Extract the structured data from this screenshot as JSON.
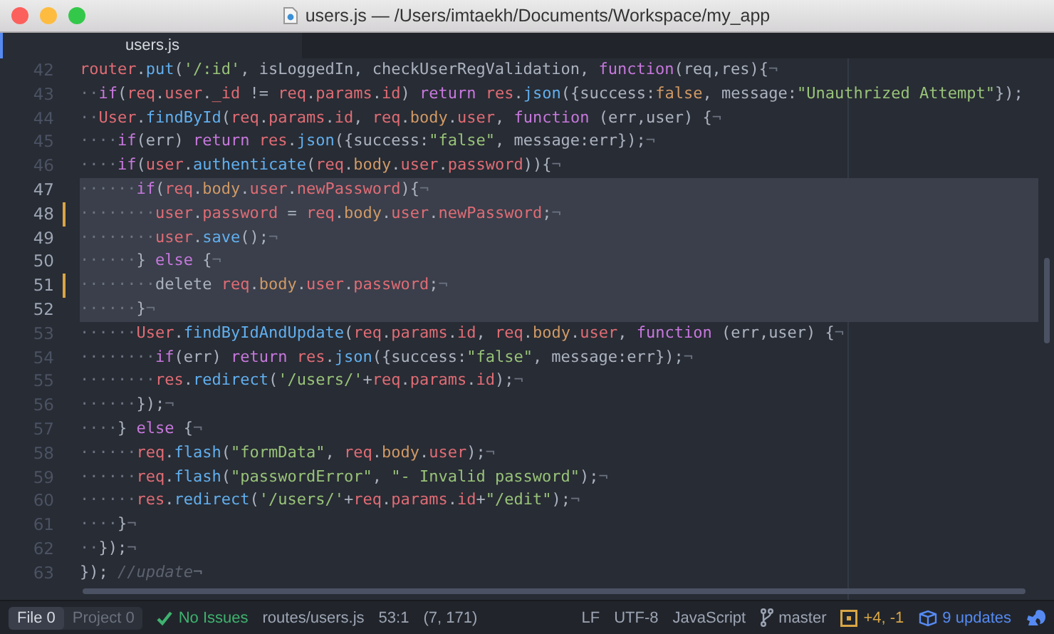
{
  "window": {
    "title": "users.js — /Users/imtaekh/Documents/Workspace/my_app"
  },
  "tabs": [
    {
      "label": "users.js",
      "selected": true
    }
  ],
  "lines": [
    {
      "number": "42",
      "selected": false,
      "modified": false,
      "tokens": [
        {
          "text": "router",
          "kind": "variable"
        },
        {
          "text": ".",
          "kind": "plain"
        },
        {
          "text": "put",
          "kind": "function"
        },
        {
          "text": "(",
          "kind": "plain"
        },
        {
          "text": "'/:id'",
          "kind": "string"
        },
        {
          "text": ", isLoggedIn, checkUserRegValidation, ",
          "kind": "plain"
        },
        {
          "text": "function",
          "kind": "keyword"
        },
        {
          "text": "(req,res){",
          "kind": "plain"
        },
        {
          "text": "¬",
          "kind": "invisible"
        }
      ]
    },
    {
      "number": "43",
      "selected": false,
      "modified": false,
      "tokens": [
        {
          "text": "··",
          "kind": "invisible"
        },
        {
          "text": "if",
          "kind": "keyword"
        },
        {
          "text": "(",
          "kind": "plain"
        },
        {
          "text": "req",
          "kind": "variable"
        },
        {
          "text": ".",
          "kind": "plain"
        },
        {
          "text": "user",
          "kind": "variable"
        },
        {
          "text": ".",
          "kind": "plain"
        },
        {
          "text": "_id",
          "kind": "variable"
        },
        {
          "text": " != ",
          "kind": "plain"
        },
        {
          "text": "req",
          "kind": "variable"
        },
        {
          "text": ".",
          "kind": "plain"
        },
        {
          "text": "params",
          "kind": "variable"
        },
        {
          "text": ".",
          "kind": "plain"
        },
        {
          "text": "id",
          "kind": "variable"
        },
        {
          "text": ") ",
          "kind": "plain"
        },
        {
          "text": "return ",
          "kind": "keyword"
        },
        {
          "text": "res",
          "kind": "variable"
        },
        {
          "text": ".",
          "kind": "plain"
        },
        {
          "text": "json",
          "kind": "function"
        },
        {
          "text": "({success:",
          "kind": "plain"
        },
        {
          "text": "false",
          "kind": "constant"
        },
        {
          "text": ", message:",
          "kind": "plain"
        },
        {
          "text": "\"Unauthrized Attempt\"",
          "kind": "string"
        },
        {
          "text": "});",
          "kind": "plain"
        }
      ]
    },
    {
      "number": "44",
      "selected": false,
      "modified": false,
      "tokens": [
        {
          "text": "··",
          "kind": "invisible"
        },
        {
          "text": "User",
          "kind": "variable"
        },
        {
          "text": ".",
          "kind": "plain"
        },
        {
          "text": "findById",
          "kind": "function"
        },
        {
          "text": "(",
          "kind": "plain"
        },
        {
          "text": "req",
          "kind": "variable"
        },
        {
          "text": ".",
          "kind": "plain"
        },
        {
          "text": "params",
          "kind": "variable"
        },
        {
          "text": ".",
          "kind": "plain"
        },
        {
          "text": "id",
          "kind": "variable"
        },
        {
          "text": ", ",
          "kind": "plain"
        },
        {
          "text": "req",
          "kind": "variable"
        },
        {
          "text": ".",
          "kind": "plain"
        },
        {
          "text": "body",
          "kind": "constant"
        },
        {
          "text": ".",
          "kind": "plain"
        },
        {
          "text": "user",
          "kind": "variable"
        },
        {
          "text": ", ",
          "kind": "plain"
        },
        {
          "text": "function",
          "kind": "keyword"
        },
        {
          "text": " (err,user) {",
          "kind": "plain"
        },
        {
          "text": "¬",
          "kind": "invisible"
        }
      ]
    },
    {
      "number": "45",
      "selected": false,
      "modified": false,
      "tokens": [
        {
          "text": "····",
          "kind": "invisible"
        },
        {
          "text": "if",
          "kind": "keyword"
        },
        {
          "text": "(err) ",
          "kind": "plain"
        },
        {
          "text": "return ",
          "kind": "keyword"
        },
        {
          "text": "res",
          "kind": "variable"
        },
        {
          "text": ".",
          "kind": "plain"
        },
        {
          "text": "json",
          "kind": "function"
        },
        {
          "text": "({success:",
          "kind": "plain"
        },
        {
          "text": "\"false\"",
          "kind": "string"
        },
        {
          "text": ", message:err});",
          "kind": "plain"
        },
        {
          "text": "¬",
          "kind": "invisible"
        }
      ]
    },
    {
      "number": "46",
      "selected": false,
      "modified": false,
      "tokens": [
        {
          "text": "····",
          "kind": "invisible"
        },
        {
          "text": "if",
          "kind": "keyword"
        },
        {
          "text": "(",
          "kind": "plain"
        },
        {
          "text": "user",
          "kind": "variable"
        },
        {
          "text": ".",
          "kind": "plain"
        },
        {
          "text": "authenticate",
          "kind": "function"
        },
        {
          "text": "(",
          "kind": "plain"
        },
        {
          "text": "req",
          "kind": "variable"
        },
        {
          "text": ".",
          "kind": "plain"
        },
        {
          "text": "body",
          "kind": "constant"
        },
        {
          "text": ".",
          "kind": "plain"
        },
        {
          "text": "user",
          "kind": "variable"
        },
        {
          "text": ".",
          "kind": "plain"
        },
        {
          "text": "password",
          "kind": "variable"
        },
        {
          "text": ")){",
          "kind": "plain"
        },
        {
          "text": "¬",
          "kind": "invisible"
        }
      ]
    },
    {
      "number": "47",
      "selected": true,
      "modified": false,
      "tokens": [
        {
          "text": "······",
          "kind": "invisible"
        },
        {
          "text": "if",
          "kind": "keyword"
        },
        {
          "text": "(",
          "kind": "plain"
        },
        {
          "text": "req",
          "kind": "variable"
        },
        {
          "text": ".",
          "kind": "plain"
        },
        {
          "text": "body",
          "kind": "constant"
        },
        {
          "text": ".",
          "kind": "plain"
        },
        {
          "text": "user",
          "kind": "variable"
        },
        {
          "text": ".",
          "kind": "plain"
        },
        {
          "text": "newPassword",
          "kind": "variable"
        },
        {
          "text": "){",
          "kind": "plain"
        },
        {
          "text": "¬",
          "kind": "invisible"
        }
      ]
    },
    {
      "number": "48",
      "selected": true,
      "modified": true,
      "tokens": [
        {
          "text": "········",
          "kind": "invisible"
        },
        {
          "text": "user",
          "kind": "variable"
        },
        {
          "text": ".",
          "kind": "plain"
        },
        {
          "text": "password",
          "kind": "variable"
        },
        {
          "text": " = ",
          "kind": "plain"
        },
        {
          "text": "req",
          "kind": "variable"
        },
        {
          "text": ".",
          "kind": "plain"
        },
        {
          "text": "body",
          "kind": "constant"
        },
        {
          "text": ".",
          "kind": "plain"
        },
        {
          "text": "user",
          "kind": "variable"
        },
        {
          "text": ".",
          "kind": "plain"
        },
        {
          "text": "newPassword",
          "kind": "variable"
        },
        {
          "text": ";",
          "kind": "plain"
        },
        {
          "text": "¬",
          "kind": "invisible"
        }
      ]
    },
    {
      "number": "49",
      "selected": true,
      "modified": false,
      "tokens": [
        {
          "text": "········",
          "kind": "invisible"
        },
        {
          "text": "user",
          "kind": "variable"
        },
        {
          "text": ".",
          "kind": "plain"
        },
        {
          "text": "save",
          "kind": "function"
        },
        {
          "text": "();",
          "kind": "plain"
        },
        {
          "text": "¬",
          "kind": "invisible"
        }
      ]
    },
    {
      "number": "50",
      "selected": true,
      "modified": false,
      "tokens": [
        {
          "text": "······",
          "kind": "invisible"
        },
        {
          "text": "} ",
          "kind": "plain"
        },
        {
          "text": "else",
          "kind": "keyword"
        },
        {
          "text": " {",
          "kind": "plain"
        },
        {
          "text": "¬",
          "kind": "invisible"
        }
      ]
    },
    {
      "number": "51",
      "selected": true,
      "modified": true,
      "tokens": [
        {
          "text": "········",
          "kind": "invisible"
        },
        {
          "text": "delete ",
          "kind": "plain"
        },
        {
          "text": "req",
          "kind": "variable"
        },
        {
          "text": ".",
          "kind": "plain"
        },
        {
          "text": "body",
          "kind": "constant"
        },
        {
          "text": ".",
          "kind": "plain"
        },
        {
          "text": "user",
          "kind": "variable"
        },
        {
          "text": ".",
          "kind": "plain"
        },
        {
          "text": "password",
          "kind": "variable"
        },
        {
          "text": ";",
          "kind": "plain"
        },
        {
          "text": "¬",
          "kind": "invisible"
        }
      ]
    },
    {
      "number": "52",
      "selected": true,
      "modified": false,
      "tokens": [
        {
          "text": "······",
          "kind": "invisible"
        },
        {
          "text": "}",
          "kind": "plain"
        },
        {
          "text": "¬",
          "kind": "invisible"
        }
      ]
    },
    {
      "number": "53",
      "selected": false,
      "modified": false,
      "tokens": [
        {
          "text": "······",
          "kind": "invisible"
        },
        {
          "text": "User",
          "kind": "variable"
        },
        {
          "text": ".",
          "kind": "plain"
        },
        {
          "text": "findByIdAndUpdate",
          "kind": "function"
        },
        {
          "text": "(",
          "kind": "plain"
        },
        {
          "text": "req",
          "kind": "variable"
        },
        {
          "text": ".",
          "kind": "plain"
        },
        {
          "text": "params",
          "kind": "variable"
        },
        {
          "text": ".",
          "kind": "plain"
        },
        {
          "text": "id",
          "kind": "variable"
        },
        {
          "text": ", ",
          "kind": "plain"
        },
        {
          "text": "req",
          "kind": "variable"
        },
        {
          "text": ".",
          "kind": "plain"
        },
        {
          "text": "body",
          "kind": "constant"
        },
        {
          "text": ".",
          "kind": "plain"
        },
        {
          "text": "user",
          "kind": "variable"
        },
        {
          "text": ", ",
          "kind": "plain"
        },
        {
          "text": "function",
          "kind": "keyword"
        },
        {
          "text": " (err,user) {",
          "kind": "plain"
        },
        {
          "text": "¬",
          "kind": "invisible"
        }
      ]
    },
    {
      "number": "54",
      "selected": false,
      "modified": false,
      "tokens": [
        {
          "text": "········",
          "kind": "invisible"
        },
        {
          "text": "if",
          "kind": "keyword"
        },
        {
          "text": "(err) ",
          "kind": "plain"
        },
        {
          "text": "return ",
          "kind": "keyword"
        },
        {
          "text": "res",
          "kind": "variable"
        },
        {
          "text": ".",
          "kind": "plain"
        },
        {
          "text": "json",
          "kind": "function"
        },
        {
          "text": "({success:",
          "kind": "plain"
        },
        {
          "text": "\"false\"",
          "kind": "string"
        },
        {
          "text": ", message:err});",
          "kind": "plain"
        },
        {
          "text": "¬",
          "kind": "invisible"
        }
      ]
    },
    {
      "number": "55",
      "selected": false,
      "modified": false,
      "tokens": [
        {
          "text": "········",
          "kind": "invisible"
        },
        {
          "text": "res",
          "kind": "variable"
        },
        {
          "text": ".",
          "kind": "plain"
        },
        {
          "text": "redirect",
          "kind": "function"
        },
        {
          "text": "(",
          "kind": "plain"
        },
        {
          "text": "'/users/'",
          "kind": "string"
        },
        {
          "text": "+",
          "kind": "plain"
        },
        {
          "text": "req",
          "kind": "variable"
        },
        {
          "text": ".",
          "kind": "plain"
        },
        {
          "text": "params",
          "kind": "variable"
        },
        {
          "text": ".",
          "kind": "plain"
        },
        {
          "text": "id",
          "kind": "variable"
        },
        {
          "text": ");",
          "kind": "plain"
        },
        {
          "text": "¬",
          "kind": "invisible"
        }
      ]
    },
    {
      "number": "56",
      "selected": false,
      "modified": false,
      "tokens": [
        {
          "text": "······",
          "kind": "invisible"
        },
        {
          "text": "});",
          "kind": "plain"
        },
        {
          "text": "¬",
          "kind": "invisible"
        }
      ]
    },
    {
      "number": "57",
      "selected": false,
      "modified": false,
      "tokens": [
        {
          "text": "····",
          "kind": "invisible"
        },
        {
          "text": "} ",
          "kind": "plain"
        },
        {
          "text": "else",
          "kind": "keyword"
        },
        {
          "text": " {",
          "kind": "plain"
        },
        {
          "text": "¬",
          "kind": "invisible"
        }
      ]
    },
    {
      "number": "58",
      "selected": false,
      "modified": false,
      "tokens": [
        {
          "text": "······",
          "kind": "invisible"
        },
        {
          "text": "req",
          "kind": "variable"
        },
        {
          "text": ".",
          "kind": "plain"
        },
        {
          "text": "flash",
          "kind": "function"
        },
        {
          "text": "(",
          "kind": "plain"
        },
        {
          "text": "\"formData\"",
          "kind": "string"
        },
        {
          "text": ", ",
          "kind": "plain"
        },
        {
          "text": "req",
          "kind": "variable"
        },
        {
          "text": ".",
          "kind": "plain"
        },
        {
          "text": "body",
          "kind": "constant"
        },
        {
          "text": ".",
          "kind": "plain"
        },
        {
          "text": "user",
          "kind": "variable"
        },
        {
          "text": ");",
          "kind": "plain"
        },
        {
          "text": "¬",
          "kind": "invisible"
        }
      ]
    },
    {
      "number": "59",
      "selected": false,
      "modified": false,
      "tokens": [
        {
          "text": "······",
          "kind": "invisible"
        },
        {
          "text": "req",
          "kind": "variable"
        },
        {
          "text": ".",
          "kind": "plain"
        },
        {
          "text": "flash",
          "kind": "function"
        },
        {
          "text": "(",
          "kind": "plain"
        },
        {
          "text": "\"passwordError\"",
          "kind": "string"
        },
        {
          "text": ", ",
          "kind": "plain"
        },
        {
          "text": "\"- Invalid password\"",
          "kind": "string"
        },
        {
          "text": ");",
          "kind": "plain"
        },
        {
          "text": "¬",
          "kind": "invisible"
        }
      ]
    },
    {
      "number": "60",
      "selected": false,
      "modified": false,
      "tokens": [
        {
          "text": "······",
          "kind": "invisible"
        },
        {
          "text": "res",
          "kind": "variable"
        },
        {
          "text": ".",
          "kind": "plain"
        },
        {
          "text": "redirect",
          "kind": "function"
        },
        {
          "text": "(",
          "kind": "plain"
        },
        {
          "text": "'/users/'",
          "kind": "string"
        },
        {
          "text": "+",
          "kind": "plain"
        },
        {
          "text": "req",
          "kind": "variable"
        },
        {
          "text": ".",
          "kind": "plain"
        },
        {
          "text": "params",
          "kind": "variable"
        },
        {
          "text": ".",
          "kind": "plain"
        },
        {
          "text": "id",
          "kind": "variable"
        },
        {
          "text": "+",
          "kind": "plain"
        },
        {
          "text": "\"/edit\"",
          "kind": "string"
        },
        {
          "text": ");",
          "kind": "plain"
        },
        {
          "text": "¬",
          "kind": "invisible"
        }
      ]
    },
    {
      "number": "61",
      "selected": false,
      "modified": false,
      "tokens": [
        {
          "text": "····",
          "kind": "invisible"
        },
        {
          "text": "}",
          "kind": "plain"
        },
        {
          "text": "¬",
          "kind": "invisible"
        }
      ]
    },
    {
      "number": "62",
      "selected": false,
      "modified": false,
      "tokens": [
        {
          "text": "··",
          "kind": "invisible"
        },
        {
          "text": "});",
          "kind": "plain"
        },
        {
          "text": "¬",
          "kind": "invisible"
        }
      ]
    },
    {
      "number": "63",
      "selected": false,
      "modified": false,
      "tokens": [
        {
          "text": "}); ",
          "kind": "plain"
        },
        {
          "text": "//update",
          "kind": "comment"
        },
        {
          "text": "¬",
          "kind": "invisible"
        }
      ]
    }
  ],
  "status_bar": {
    "scopes": [
      {
        "label": "File",
        "count": "0",
        "selected": true
      },
      {
        "label": "Project",
        "count": "0",
        "selected": false
      }
    ],
    "issues": "No Issues",
    "path": "routes/users.js",
    "cursor": "53:1",
    "selection": "(7, 171)",
    "line_ending": "LF",
    "encoding": "UTF-8",
    "grammar": "JavaScript",
    "branch": "master",
    "diff": "+4, -1",
    "updates": "9 updates"
  }
}
